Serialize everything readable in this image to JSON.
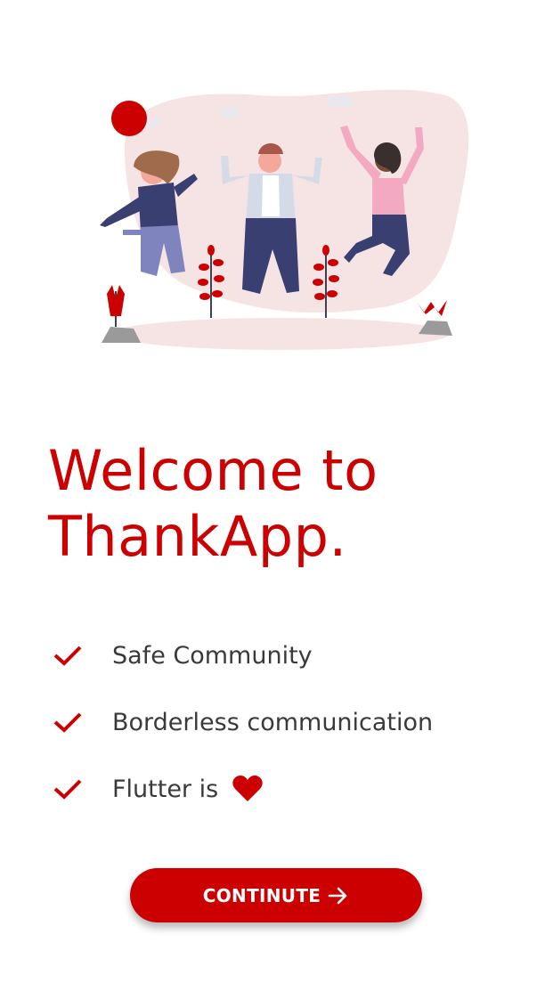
{
  "colors": {
    "primary": "#cc0000",
    "text": "#3a3a3a",
    "background": "#ffffff"
  },
  "illustration": {
    "icon": "people-jumping-illustration"
  },
  "title": {
    "line1": "Welcome to",
    "line2": "ThankApp."
  },
  "features": [
    {
      "icon": "check-icon",
      "label": "Safe Community"
    },
    {
      "icon": "check-icon",
      "label": "Borderless communication"
    },
    {
      "icon": "check-icon",
      "label": "Flutter is",
      "suffix_icon": "heart-icon"
    }
  ],
  "continue_button": {
    "label": "CONTINUTE",
    "icon": "arrow-right-icon"
  }
}
